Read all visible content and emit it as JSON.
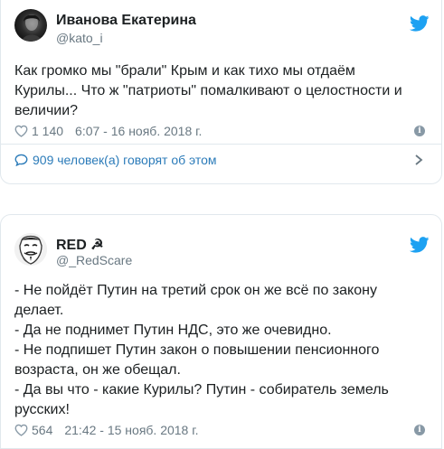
{
  "tweets": [
    {
      "author": {
        "display_name": "Иванова Екатерина",
        "handle": "@kato_i"
      },
      "text_lines": [
        "Как громко мы \"брали\" Крым и как тихо мы отдаём",
        "Курилы... Что ж \"патриоты\" помалкивают о целостности и",
        "величии?"
      ],
      "likes": "1 140",
      "timestamp": "6:07 - 16 нояб. 2018 г.",
      "conversation_label": "909 человек(а) говорят об этом"
    },
    {
      "author": {
        "display_name": "RED ☭",
        "handle": "@_RedScare"
      },
      "text_lines": [
        "- Не пойдёт Путин на третий срок он же всё по закону",
        "делает.",
        "- Да не поднимет Путин НДС, это же очевидно.",
        "- Не подпишет Путин закон о повышении пенсионного",
        "возраста, он же обещал.",
        "- Да вы что - какие Курилы? Путин - собиратель земель",
        "русских!"
      ],
      "likes": "564",
      "timestamp": "21:42 - 15 нояб. 2018 г."
    }
  ],
  "colors": {
    "twitter_blue": "#1da1f2",
    "link_blue": "#2b7bb9",
    "meta_gray": "#697882",
    "text_dark": "#1c2022",
    "border": "#e1e8ed"
  },
  "icons": {
    "brand": "twitter-bird-icon",
    "like": "heart-icon",
    "info": "info-icon",
    "conversation": "speech-bubble-icon",
    "more": "chevron-right-icon"
  }
}
